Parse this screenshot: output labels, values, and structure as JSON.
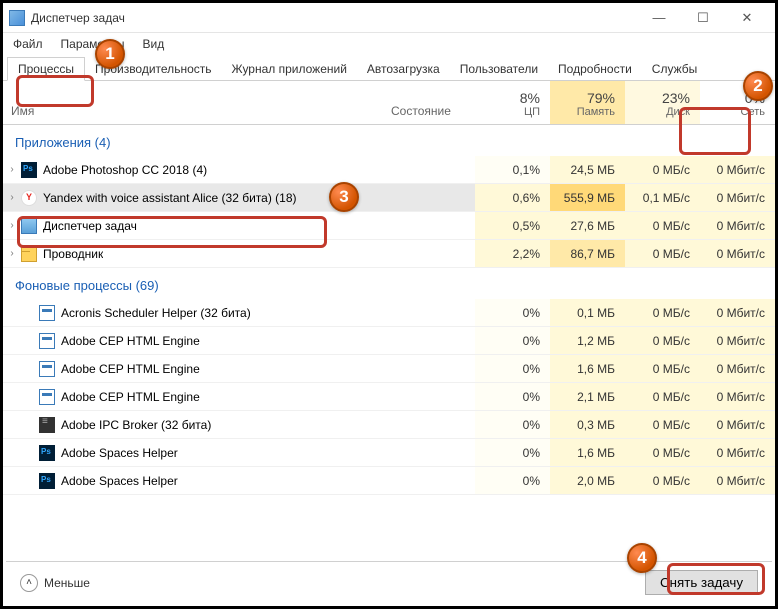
{
  "window": {
    "title": "Диспетчер задач"
  },
  "menu": {
    "file": "Файл",
    "options": "Параметры",
    "view": "Вид"
  },
  "tabs": [
    {
      "label": "Процессы",
      "active": true
    },
    {
      "label": "Производительность"
    },
    {
      "label": "Журнал приложений"
    },
    {
      "label": "Автозагрузка"
    },
    {
      "label": "Пользователи"
    },
    {
      "label": "Подробности"
    },
    {
      "label": "Службы"
    }
  ],
  "columns": {
    "name": "Имя",
    "state": "Состояние",
    "metrics": [
      {
        "pct": "8%",
        "lbl": "ЦП",
        "heat": 0
      },
      {
        "pct": "79%",
        "lbl": "Память",
        "heat": 2
      },
      {
        "pct": "23%",
        "lbl": "Диск",
        "heat": 1
      },
      {
        "pct": "0%",
        "lbl": "Сеть",
        "heat": 0
      }
    ]
  },
  "sections": {
    "apps": {
      "title": "Приложения (4)",
      "rows": [
        {
          "exp": true,
          "icon": "ps",
          "name": "Adobe Photoshop CC 2018 (4)",
          "cpu": "0,1%",
          "mem": "24,5 МБ",
          "disk": "0 МБ/с",
          "net": "0 Мбит/с",
          "heat": [
            0,
            1,
            1,
            1
          ]
        },
        {
          "exp": true,
          "icon": "ya",
          "name": "Yandex with voice assistant Alice (32 бита) (18)",
          "cpu": "0,6%",
          "mem": "555,9 МБ",
          "disk": "0,1 МБ/с",
          "net": "0 Мбит/с",
          "selected": true,
          "heat": [
            1,
            3,
            1,
            1
          ]
        },
        {
          "exp": false,
          "icon": "tm",
          "name": "Диспетчер задач",
          "cpu": "0,5%",
          "mem": "27,6 МБ",
          "disk": "0 МБ/с",
          "net": "0 Мбит/с",
          "heat": [
            1,
            1,
            1,
            1
          ]
        },
        {
          "exp": false,
          "icon": "exp",
          "name": "Проводник",
          "cpu": "2,2%",
          "mem": "86,7 МБ",
          "disk": "0 МБ/с",
          "net": "0 Мбит/с",
          "heat": [
            1,
            2,
            1,
            1
          ]
        }
      ]
    },
    "bg": {
      "title": "Фоновые процессы (69)",
      "rows": [
        {
          "icon": "gen",
          "name": "Acronis Scheduler Helper (32 бита)",
          "cpu": "0%",
          "mem": "0,1 МБ",
          "disk": "0 МБ/с",
          "net": "0 Мбит/с",
          "heat": [
            0,
            1,
            1,
            1
          ]
        },
        {
          "icon": "gen",
          "name": "Adobe CEP HTML Engine",
          "cpu": "0%",
          "mem": "1,2 МБ",
          "disk": "0 МБ/с",
          "net": "0 Мбит/с",
          "heat": [
            0,
            1,
            1,
            1
          ]
        },
        {
          "icon": "gen",
          "name": "Adobe CEP HTML Engine",
          "cpu": "0%",
          "mem": "1,6 МБ",
          "disk": "0 МБ/с",
          "net": "0 Мбит/с",
          "heat": [
            0,
            1,
            1,
            1
          ]
        },
        {
          "icon": "gen",
          "name": "Adobe CEP HTML Engine",
          "cpu": "0%",
          "mem": "2,1 МБ",
          "disk": "0 МБ/с",
          "net": "0 Мбит/с",
          "heat": [
            0,
            1,
            1,
            1
          ]
        },
        {
          "icon": "dark",
          "name": "Adobe IPC Broker (32 бита)",
          "cpu": "0%",
          "mem": "0,3 МБ",
          "disk": "0 МБ/с",
          "net": "0 Мбит/с",
          "heat": [
            0,
            1,
            1,
            1
          ]
        },
        {
          "icon": "ps",
          "name": "Adobe Spaces Helper",
          "cpu": "0%",
          "mem": "1,6 МБ",
          "disk": "0 МБ/с",
          "net": "0 Мбит/с",
          "heat": [
            0,
            1,
            1,
            1
          ]
        },
        {
          "icon": "ps",
          "name": "Adobe Spaces Helper",
          "cpu": "0%",
          "mem": "2,0 МБ",
          "disk": "0 МБ/с",
          "net": "0 Мбит/с",
          "heat": [
            0,
            1,
            1,
            1
          ]
        }
      ]
    }
  },
  "footer": {
    "less": "Меньше",
    "end_task": "Снять задачу"
  },
  "callouts": {
    "c1": "1",
    "c2": "2",
    "c3": "3",
    "c4": "4"
  }
}
